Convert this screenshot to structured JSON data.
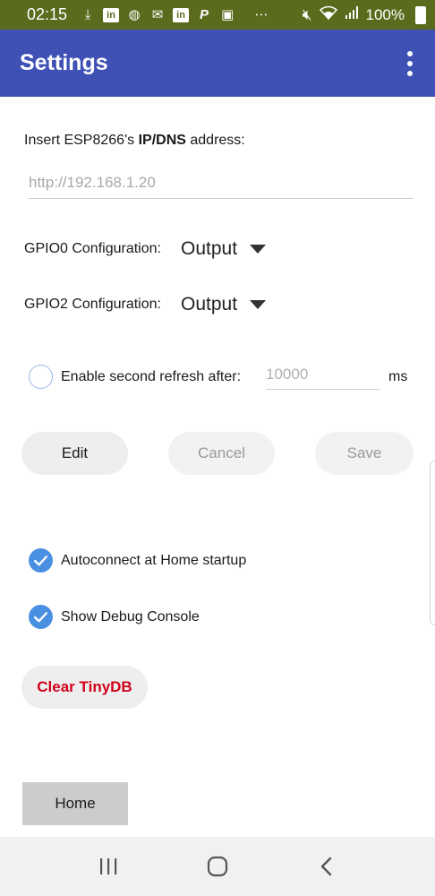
{
  "status_bar": {
    "time": "02:15",
    "battery": "100%",
    "notification_icons": [
      "download-icon",
      "linkedin-icon",
      "vodafone-icon",
      "mail-icon",
      "linkedin-icon",
      "paypal-icon",
      "gallery-icon",
      "more-icon"
    ],
    "status_icons": [
      "mute-icon",
      "wifi-icon",
      "signal-icon",
      "battery-icon"
    ],
    "color": "#5b6b1e"
  },
  "app_bar": {
    "title": "Settings",
    "color": "#3f51b5",
    "menu_icon": "overflow-menu-icon"
  },
  "ip_section": {
    "label_prefix": "Insert ESP8266's ",
    "label_bold": "IP/DNS",
    "label_suffix": " address:",
    "placeholder": "http://192.168.1.20",
    "value": ""
  },
  "gpio0": {
    "label": "GPIO0 Configuration:",
    "selected": "Output"
  },
  "gpio2": {
    "label": "GPIO2 Configuration:",
    "selected": "Output"
  },
  "refresh": {
    "label": "Enable second refresh after:",
    "placeholder": "10000",
    "unit": "ms",
    "checked": false
  },
  "buttons": {
    "edit": "Edit",
    "cancel": "Cancel",
    "save": "Save"
  },
  "checkboxes": [
    {
      "label": "Autoconnect at Home startup",
      "checked": true
    },
    {
      "label": "Show Debug Console",
      "checked": true
    }
  ],
  "clear_button": "Clear TinyDB",
  "home_button": "Home",
  "accent_color": "#4a90e2",
  "danger_color": "#d0021b"
}
